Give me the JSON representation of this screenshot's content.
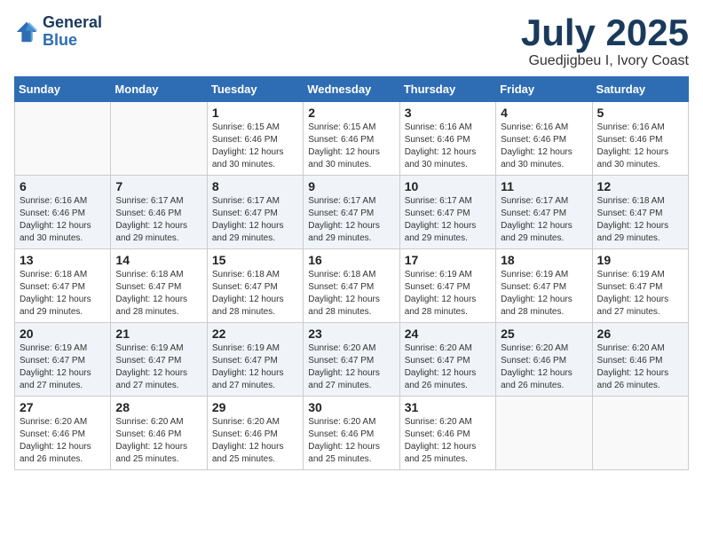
{
  "logo": {
    "line1": "General",
    "line2": "Blue"
  },
  "title": "July 2025",
  "location": "Guedjigbeu I, Ivory Coast",
  "days_of_week": [
    "Sunday",
    "Monday",
    "Tuesday",
    "Wednesday",
    "Thursday",
    "Friday",
    "Saturday"
  ],
  "weeks": [
    [
      {
        "day": "",
        "sunrise": "",
        "sunset": "",
        "daylight": ""
      },
      {
        "day": "",
        "sunrise": "",
        "sunset": "",
        "daylight": ""
      },
      {
        "day": "1",
        "sunrise": "Sunrise: 6:15 AM",
        "sunset": "Sunset: 6:46 PM",
        "daylight": "Daylight: 12 hours and 30 minutes."
      },
      {
        "day": "2",
        "sunrise": "Sunrise: 6:15 AM",
        "sunset": "Sunset: 6:46 PM",
        "daylight": "Daylight: 12 hours and 30 minutes."
      },
      {
        "day": "3",
        "sunrise": "Sunrise: 6:16 AM",
        "sunset": "Sunset: 6:46 PM",
        "daylight": "Daylight: 12 hours and 30 minutes."
      },
      {
        "day": "4",
        "sunrise": "Sunrise: 6:16 AM",
        "sunset": "Sunset: 6:46 PM",
        "daylight": "Daylight: 12 hours and 30 minutes."
      },
      {
        "day": "5",
        "sunrise": "Sunrise: 6:16 AM",
        "sunset": "Sunset: 6:46 PM",
        "daylight": "Daylight: 12 hours and 30 minutes."
      }
    ],
    [
      {
        "day": "6",
        "sunrise": "Sunrise: 6:16 AM",
        "sunset": "Sunset: 6:46 PM",
        "daylight": "Daylight: 12 hours and 30 minutes."
      },
      {
        "day": "7",
        "sunrise": "Sunrise: 6:17 AM",
        "sunset": "Sunset: 6:46 PM",
        "daylight": "Daylight: 12 hours and 29 minutes."
      },
      {
        "day": "8",
        "sunrise": "Sunrise: 6:17 AM",
        "sunset": "Sunset: 6:47 PM",
        "daylight": "Daylight: 12 hours and 29 minutes."
      },
      {
        "day": "9",
        "sunrise": "Sunrise: 6:17 AM",
        "sunset": "Sunset: 6:47 PM",
        "daylight": "Daylight: 12 hours and 29 minutes."
      },
      {
        "day": "10",
        "sunrise": "Sunrise: 6:17 AM",
        "sunset": "Sunset: 6:47 PM",
        "daylight": "Daylight: 12 hours and 29 minutes."
      },
      {
        "day": "11",
        "sunrise": "Sunrise: 6:17 AM",
        "sunset": "Sunset: 6:47 PM",
        "daylight": "Daylight: 12 hours and 29 minutes."
      },
      {
        "day": "12",
        "sunrise": "Sunrise: 6:18 AM",
        "sunset": "Sunset: 6:47 PM",
        "daylight": "Daylight: 12 hours and 29 minutes."
      }
    ],
    [
      {
        "day": "13",
        "sunrise": "Sunrise: 6:18 AM",
        "sunset": "Sunset: 6:47 PM",
        "daylight": "Daylight: 12 hours and 29 minutes."
      },
      {
        "day": "14",
        "sunrise": "Sunrise: 6:18 AM",
        "sunset": "Sunset: 6:47 PM",
        "daylight": "Daylight: 12 hours and 28 minutes."
      },
      {
        "day": "15",
        "sunrise": "Sunrise: 6:18 AM",
        "sunset": "Sunset: 6:47 PM",
        "daylight": "Daylight: 12 hours and 28 minutes."
      },
      {
        "day": "16",
        "sunrise": "Sunrise: 6:18 AM",
        "sunset": "Sunset: 6:47 PM",
        "daylight": "Daylight: 12 hours and 28 minutes."
      },
      {
        "day": "17",
        "sunrise": "Sunrise: 6:19 AM",
        "sunset": "Sunset: 6:47 PM",
        "daylight": "Daylight: 12 hours and 28 minutes."
      },
      {
        "day": "18",
        "sunrise": "Sunrise: 6:19 AM",
        "sunset": "Sunset: 6:47 PM",
        "daylight": "Daylight: 12 hours and 28 minutes."
      },
      {
        "day": "19",
        "sunrise": "Sunrise: 6:19 AM",
        "sunset": "Sunset: 6:47 PM",
        "daylight": "Daylight: 12 hours and 27 minutes."
      }
    ],
    [
      {
        "day": "20",
        "sunrise": "Sunrise: 6:19 AM",
        "sunset": "Sunset: 6:47 PM",
        "daylight": "Daylight: 12 hours and 27 minutes."
      },
      {
        "day": "21",
        "sunrise": "Sunrise: 6:19 AM",
        "sunset": "Sunset: 6:47 PM",
        "daylight": "Daylight: 12 hours and 27 minutes."
      },
      {
        "day": "22",
        "sunrise": "Sunrise: 6:19 AM",
        "sunset": "Sunset: 6:47 PM",
        "daylight": "Daylight: 12 hours and 27 minutes."
      },
      {
        "day": "23",
        "sunrise": "Sunrise: 6:20 AM",
        "sunset": "Sunset: 6:47 PM",
        "daylight": "Daylight: 12 hours and 27 minutes."
      },
      {
        "day": "24",
        "sunrise": "Sunrise: 6:20 AM",
        "sunset": "Sunset: 6:47 PM",
        "daylight": "Daylight: 12 hours and 26 minutes."
      },
      {
        "day": "25",
        "sunrise": "Sunrise: 6:20 AM",
        "sunset": "Sunset: 6:46 PM",
        "daylight": "Daylight: 12 hours and 26 minutes."
      },
      {
        "day": "26",
        "sunrise": "Sunrise: 6:20 AM",
        "sunset": "Sunset: 6:46 PM",
        "daylight": "Daylight: 12 hours and 26 minutes."
      }
    ],
    [
      {
        "day": "27",
        "sunrise": "Sunrise: 6:20 AM",
        "sunset": "Sunset: 6:46 PM",
        "daylight": "Daylight: 12 hours and 26 minutes."
      },
      {
        "day": "28",
        "sunrise": "Sunrise: 6:20 AM",
        "sunset": "Sunset: 6:46 PM",
        "daylight": "Daylight: 12 hours and 25 minutes."
      },
      {
        "day": "29",
        "sunrise": "Sunrise: 6:20 AM",
        "sunset": "Sunset: 6:46 PM",
        "daylight": "Daylight: 12 hours and 25 minutes."
      },
      {
        "day": "30",
        "sunrise": "Sunrise: 6:20 AM",
        "sunset": "Sunset: 6:46 PM",
        "daylight": "Daylight: 12 hours and 25 minutes."
      },
      {
        "day": "31",
        "sunrise": "Sunrise: 6:20 AM",
        "sunset": "Sunset: 6:46 PM",
        "daylight": "Daylight: 12 hours and 25 minutes."
      },
      {
        "day": "",
        "sunrise": "",
        "sunset": "",
        "daylight": ""
      },
      {
        "day": "",
        "sunrise": "",
        "sunset": "",
        "daylight": ""
      }
    ]
  ]
}
